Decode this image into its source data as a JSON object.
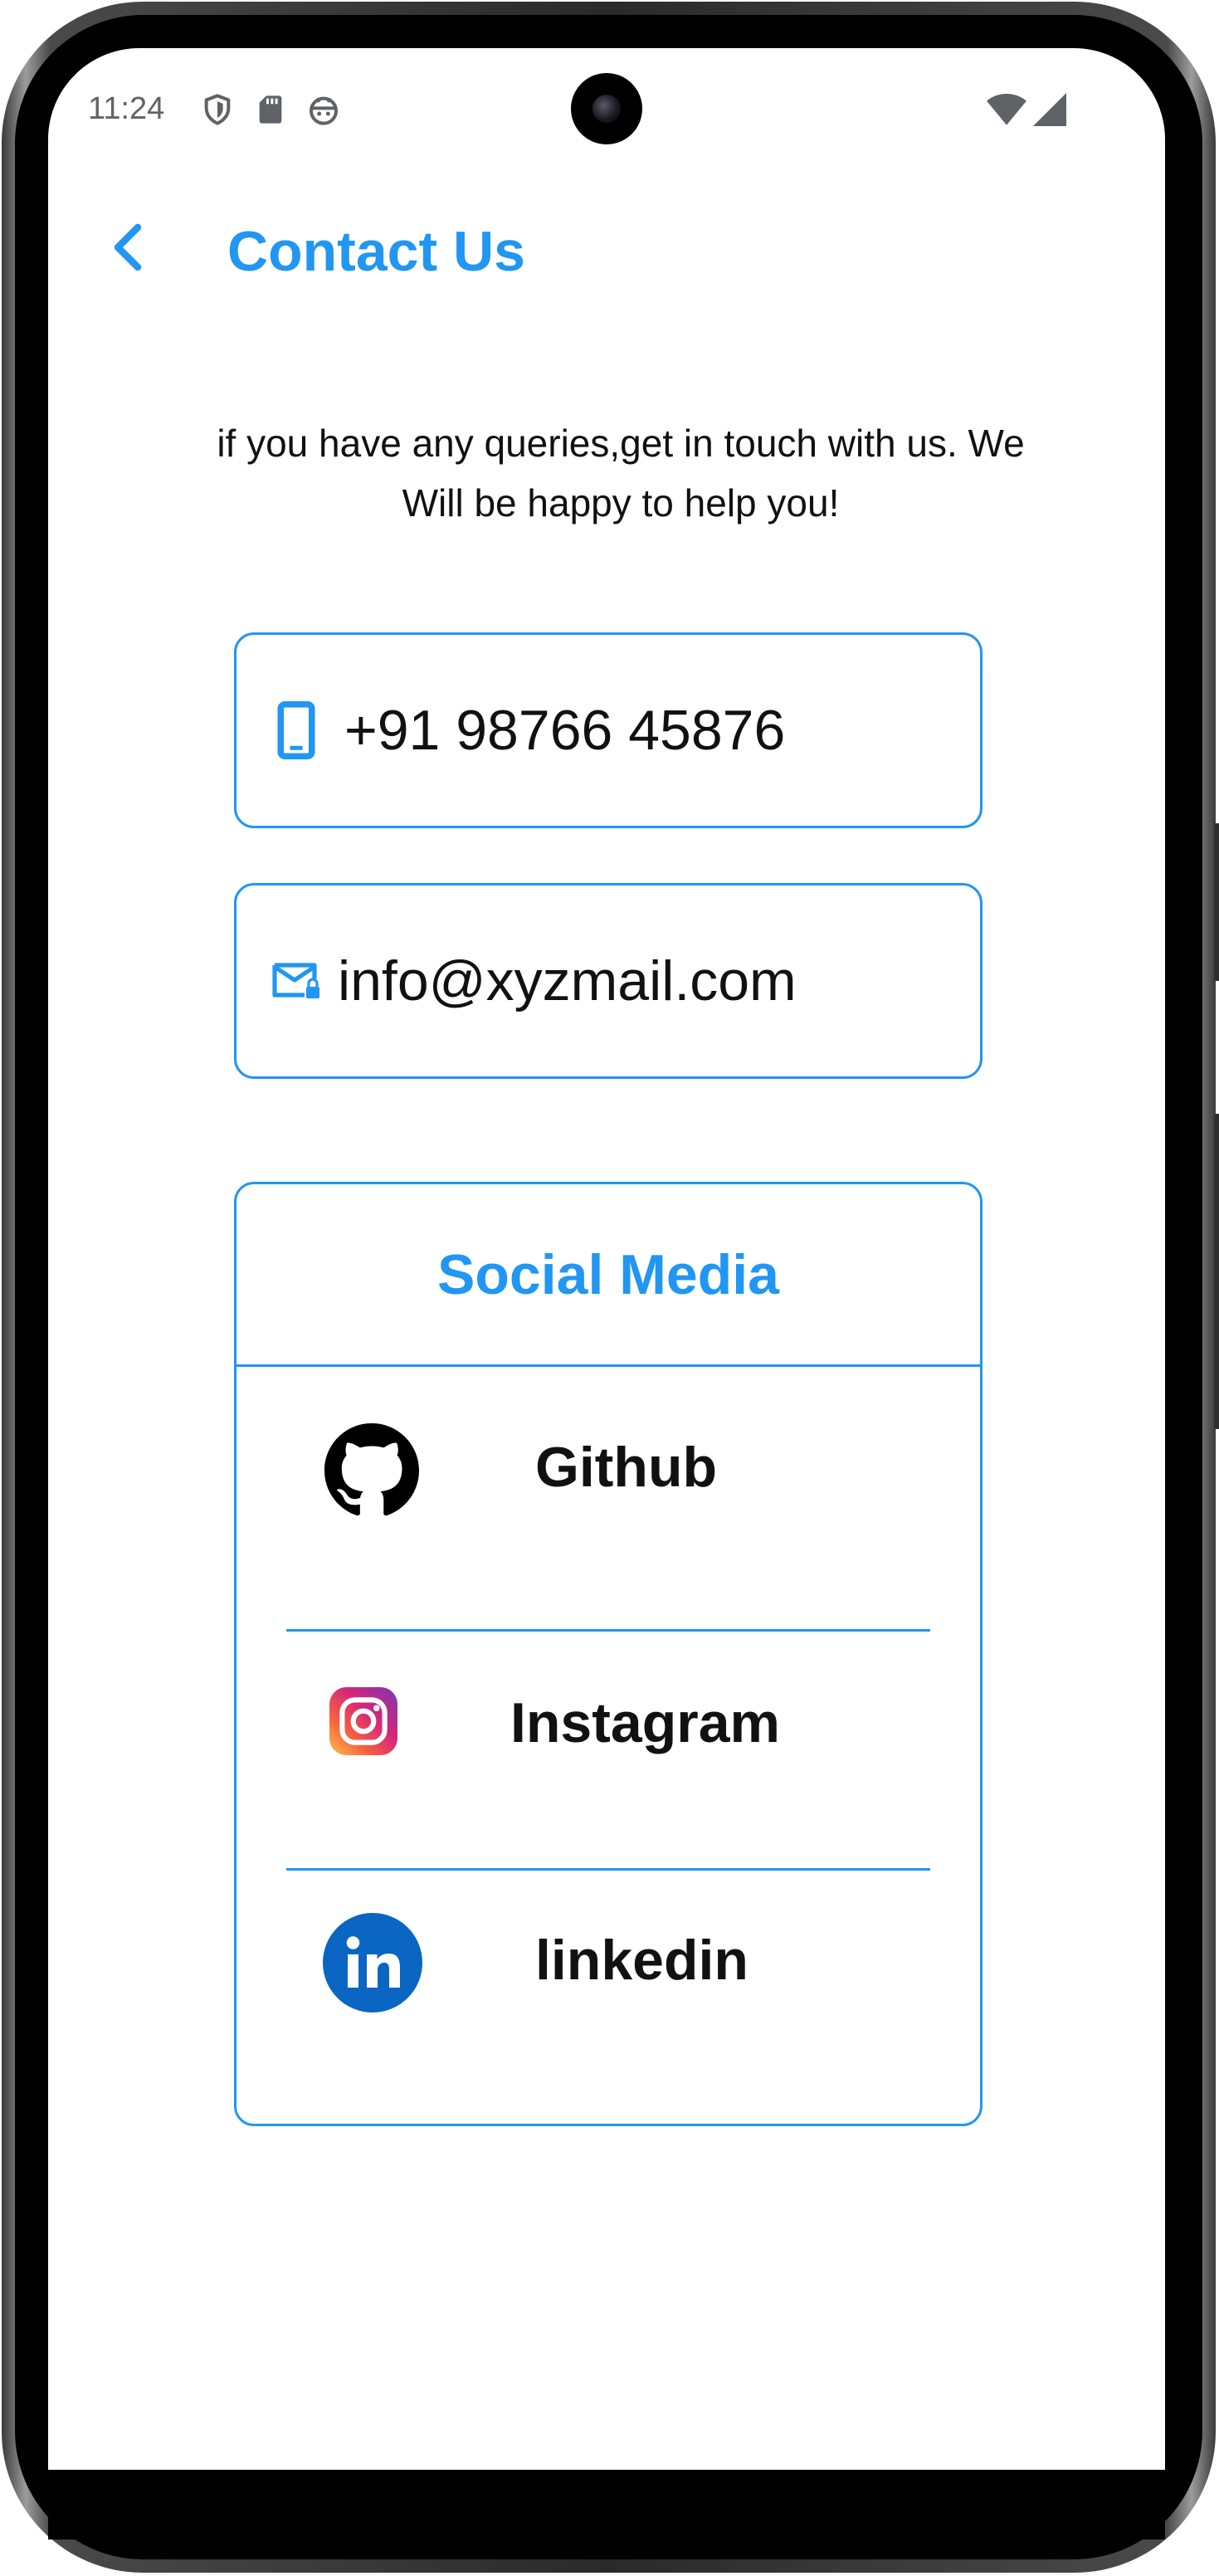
{
  "status_bar": {
    "time": "11:24",
    "left_icons": [
      "shield-icon",
      "sd-card-icon",
      "android-face-icon"
    ],
    "right_icons": [
      "wifi-icon",
      "cell-signal-icon"
    ]
  },
  "app_bar": {
    "back_icon": "chevron-left-icon",
    "title": "Contact Us"
  },
  "intro": {
    "text": "if you have any queries,get in touch with us. We Will be happy to help you!"
  },
  "contacts": {
    "phone": {
      "icon": "smartphone-icon",
      "value": "+91 98766 45876"
    },
    "email": {
      "icon": "mail-lock-icon",
      "value": "info@xyzmail.com"
    }
  },
  "social": {
    "title": "Social Media",
    "items": [
      {
        "icon": "github-icon",
        "label": "Github"
      },
      {
        "icon": "instagram-icon",
        "label": "Instagram"
      },
      {
        "icon": "linkedin-icon",
        "label": "linkedin"
      }
    ]
  },
  "colors": {
    "accent": "#2196F3",
    "text": "#111111",
    "status_text": "#5F6368",
    "linkedin": "#0A66C2"
  }
}
